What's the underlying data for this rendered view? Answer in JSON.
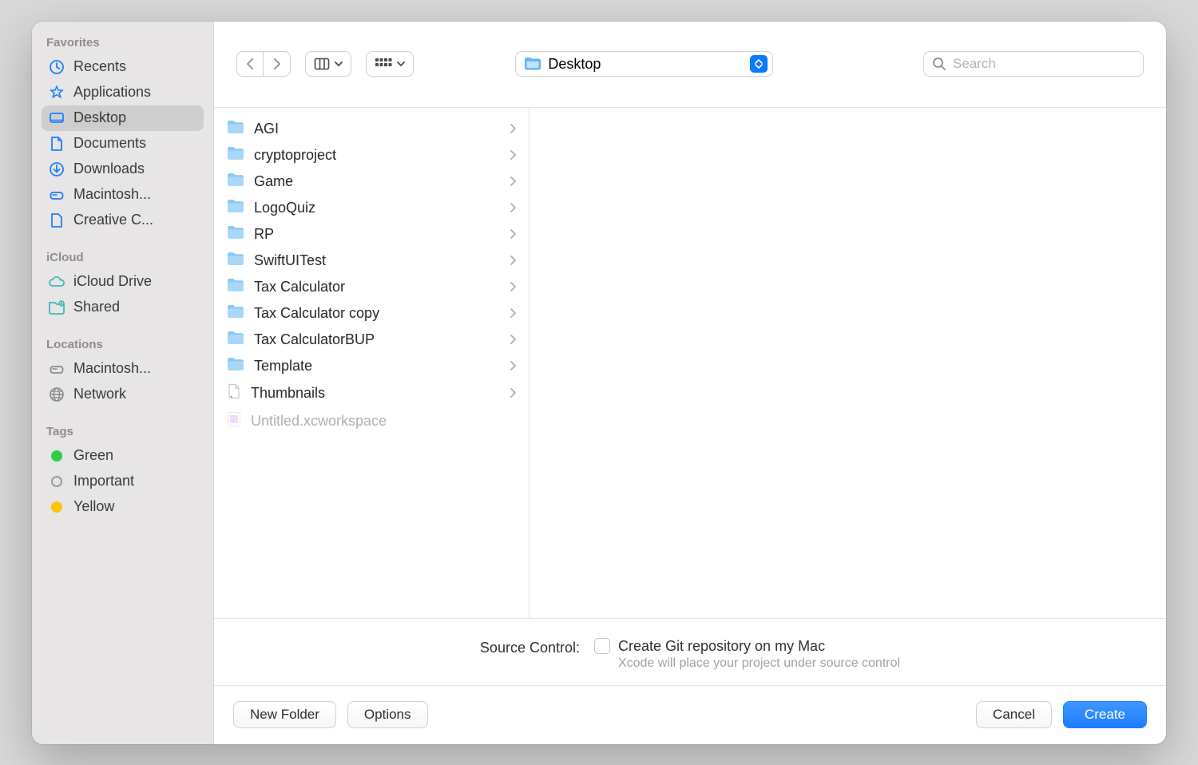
{
  "sidebar": {
    "sections": [
      {
        "title": "Favorites",
        "items": [
          {
            "icon": "clock",
            "label": "Recents",
            "color": "#1f7eff"
          },
          {
            "icon": "apps",
            "label": "Applications",
            "color": "#1f7eff"
          },
          {
            "icon": "desktop",
            "label": "Desktop",
            "color": "#1f7eff",
            "selected": true
          },
          {
            "icon": "document",
            "label": "Documents",
            "color": "#1f7eff"
          },
          {
            "icon": "download",
            "label": "Downloads",
            "color": "#1f7eff"
          },
          {
            "icon": "drive",
            "label": "Macintosh...",
            "color": "#1f7eff"
          },
          {
            "icon": "file",
            "label": "Creative C...",
            "color": "#1f7eff"
          }
        ]
      },
      {
        "title": "iCloud",
        "items": [
          {
            "icon": "cloud",
            "label": "iCloud Drive",
            "color": "#3fb9b2"
          },
          {
            "icon": "shared-folder",
            "label": "Shared",
            "color": "#3fb9b2"
          }
        ]
      },
      {
        "title": "Locations",
        "items": [
          {
            "icon": "drive",
            "label": "Macintosh...",
            "color": "#8b8b8b"
          },
          {
            "icon": "network",
            "label": "Network",
            "color": "#8b8b8b"
          }
        ]
      },
      {
        "title": "Tags",
        "items": [
          {
            "icon": "tag-dot",
            "label": "Green",
            "color": "#2fce46"
          },
          {
            "icon": "tag-circle",
            "label": "Important",
            "color": "#9a9a9a"
          },
          {
            "icon": "tag-dot",
            "label": "Yellow",
            "color": "#ffc400"
          }
        ]
      }
    ]
  },
  "toolbar": {
    "location_label": "Desktop",
    "search_placeholder": "Search"
  },
  "files": [
    {
      "type": "folder",
      "name": "AGI",
      "hasChildren": true
    },
    {
      "type": "folder",
      "name": "cryptoproject",
      "hasChildren": true
    },
    {
      "type": "folder",
      "name": "Game",
      "hasChildren": true
    },
    {
      "type": "folder",
      "name": "LogoQuiz",
      "hasChildren": true
    },
    {
      "type": "folder",
      "name": "RP",
      "hasChildren": true
    },
    {
      "type": "folder",
      "name": "SwiftUITest",
      "hasChildren": true
    },
    {
      "type": "folder",
      "name": "Tax Calculator",
      "hasChildren": true
    },
    {
      "type": "folder",
      "name": "Tax Calculator copy",
      "hasChildren": true
    },
    {
      "type": "folder",
      "name": "Tax CalculatorBUP",
      "hasChildren": true
    },
    {
      "type": "folder",
      "name": "Template",
      "hasChildren": true
    },
    {
      "type": "file-generic",
      "name": "Thumbnails",
      "hasChildren": true
    },
    {
      "type": "xcworkspace",
      "name": "Untitled.xcworkspace",
      "hasChildren": false,
      "dim": true
    }
  ],
  "options": {
    "label": "Source Control:",
    "checkbox_label": "Create Git repository on my Mac",
    "hint": "Xcode will place your project under source control"
  },
  "buttons": {
    "new_folder": "New Folder",
    "options": "Options",
    "cancel": "Cancel",
    "create": "Create"
  }
}
